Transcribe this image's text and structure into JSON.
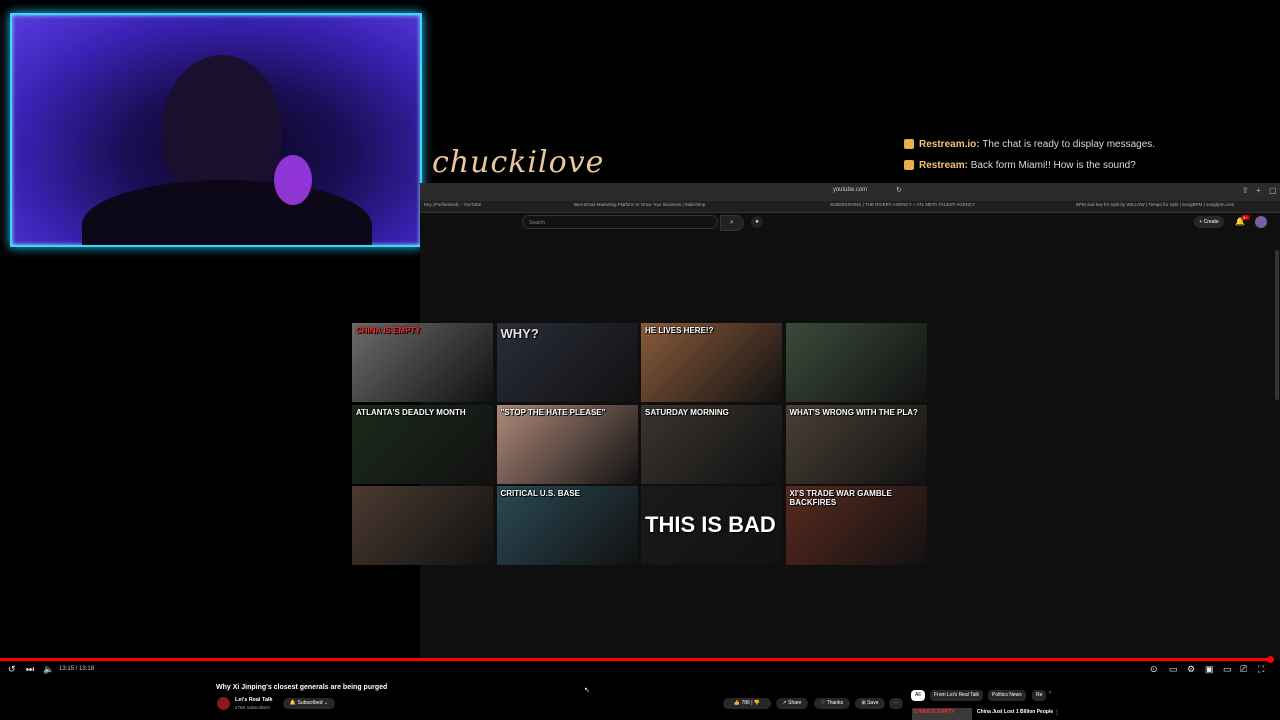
{
  "overlay": {
    "signature": "chuckilove",
    "chat": [
      {
        "user": "Restream.io",
        "message": " The chat is ready to display messages."
      },
      {
        "user": "Restream",
        "message": " Back form Miami!! How is the sound?"
      }
    ]
  },
  "browser": {
    "url": "youtube.com",
    "tabs": [
      "Key (Prefinished) – YouTube",
      "Best Email Marketing Platform to Grow Your Business | Mailchimp",
      "SUBMISSIONS | THE RIVERY AGENCY – ATL META TALENT AGENCY",
      "BPM and key for Split by WILLOW | Tempo for Split | SongBPM | songbpm.com"
    ],
    "search_placeholder": "Search",
    "create_label": "Create",
    "notif_count": "9+"
  },
  "thumbnails": [
    {
      "caption": "CHINA IS EMPTY",
      "bg": "#6b6b6b",
      "capColor": "#ff2b2b"
    },
    {
      "caption": "WHY?",
      "bg": "#2a2d3a",
      "capColor": "#e0e0e0"
    },
    {
      "caption": "HE LIVES HERE!?",
      "bg": "#8a5b3a",
      "capColor": "#ffffff"
    },
    {
      "caption": "",
      "bg": "#3a4b3a",
      "capColor": "#ffffff"
    },
    {
      "caption": "ATLANTA'S DEADLY MONTH",
      "bg": "#1b2a1b",
      "capColor": "#ffffff"
    },
    {
      "caption": "\"STOP THE HATE PLEASE\"",
      "bg": "#b08a7a",
      "capColor": "#ffffff"
    },
    {
      "caption": "SATURDAY MORNING",
      "bg": "#3a3530",
      "capColor": "#ffffff"
    },
    {
      "caption": "WHAT'S WRONG WITH THE PLA?",
      "bg": "#4a4035",
      "capColor": "#ffffff"
    },
    {
      "caption": "",
      "bg": "#4a3a30",
      "capColor": "#ffffff"
    },
    {
      "caption": "CRITICAL U.S. BASE",
      "bg": "#2a4a55",
      "capColor": "#ffffff"
    },
    {
      "caption": "THIS IS BAD",
      "bg": "#1a1a1a",
      "capColor": "#ffffff"
    },
    {
      "caption": "XI'S TRADE WAR GAMBLE BACKFIRES",
      "bg": "#5a2a20",
      "capColor": "#ffffff"
    }
  ],
  "player": {
    "time": "13:15 / 13:18",
    "progress_fraction": 0.995
  },
  "video": {
    "title": "Why Xi Jinping's closest generals are being purged",
    "channel": "Lei's Real Talk",
    "subscribers": "276K subscribers",
    "subscribed_label": "Subscribed",
    "likes": "786",
    "share_label": "Share",
    "thanks_label": "Thanks",
    "save_label": "Save",
    "more_label": "⋯"
  },
  "chips": [
    "All",
    "From Lei's Real Talk",
    "Politics News",
    "Re"
  ],
  "recommended": {
    "title": "China Just Lost 1 Billion People",
    "thumb_caption": "CHINA IS EMPTY"
  },
  "colors": {
    "accent": "#ff0000",
    "cam_border": "#39d9ff",
    "chat_user": "#f0c574"
  }
}
